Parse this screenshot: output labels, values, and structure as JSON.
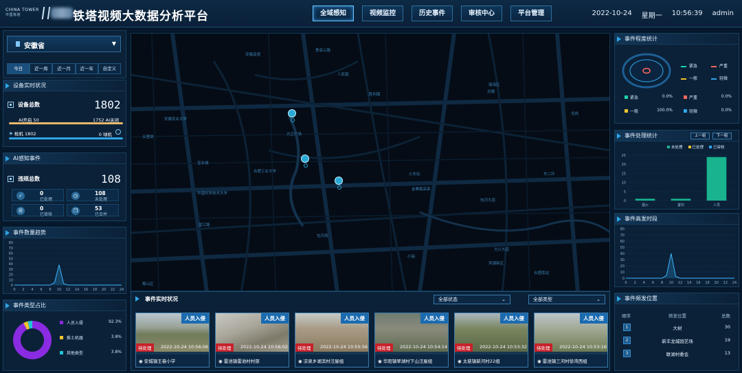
{
  "header": {
    "logo_text": "CHINA TOWER",
    "logo_sub": "中国铁塔",
    "title": "铁塔视频大数据分析平台",
    "nav": [
      "全域感知",
      "视频监控",
      "历史事件",
      "审核中心",
      "平台管理"
    ],
    "date": "2022-10-24",
    "weekday": "星期一",
    "time": "10:56:39",
    "user": "admin"
  },
  "left": {
    "province": "安徽省",
    "ranges": [
      "今日",
      "近一周",
      "近一月",
      "近一年",
      "自定义"
    ],
    "device": {
      "title": "设备实时状况",
      "total_label": "设备总数",
      "total": "1802",
      "ai_on": "AI开启 50",
      "ai_off": "1752 AI关闭",
      "gun": "枪机 1802",
      "dome": "0 球机"
    },
    "ai": {
      "title": "AI感知事件",
      "total_label": "违规总数",
      "total": "108",
      "cells": [
        {
          "value": "0",
          "label": "已处理"
        },
        {
          "value": "108",
          "label": "未处理"
        },
        {
          "value": "0",
          "label": "已审核"
        },
        {
          "value": "53",
          "label": "已合并"
        }
      ]
    },
    "trend": {
      "title": "事件数量趋势",
      "y_ticks": [
        "80",
        "70",
        "60",
        "50",
        "40",
        "30",
        "20",
        "10",
        "0"
      ],
      "x_ticks": [
        "0",
        "2",
        "4",
        "6",
        "8",
        "10",
        "12",
        "14",
        "16",
        "18",
        "20",
        "22",
        "24"
      ]
    },
    "types": {
      "title": "事件类型占比",
      "items": [
        {
          "label": "人员入侵",
          "value": "92.3%",
          "color": "#8a2be2"
        },
        {
          "label": "推土机器",
          "value": "3.8%",
          "color": "#f0c330"
        },
        {
          "label": "其他类型",
          "value": "3.8%",
          "color": "#21c4d6"
        }
      ]
    }
  },
  "map": {
    "labels": [
      {
        "t": "安徽高速"
      },
      {
        "t": "季高公路"
      },
      {
        "t": "人民路"
      },
      {
        "t": "方正广场"
      },
      {
        "t": "安徽农业大学"
      },
      {
        "t": "五里墩"
      },
      {
        "t": "合肥工业大学"
      },
      {
        "t": "宝业城"
      },
      {
        "t": "中国科学技术大学"
      },
      {
        "t": "望江路"
      },
      {
        "t": "包河苑"
      },
      {
        "t": "滨湖新区"
      },
      {
        "t": "瑶海区"
      },
      {
        "t": "火车站"
      },
      {
        "t": "包河大道"
      },
      {
        "t": "东二环"
      },
      {
        "t": "金寨路高架"
      },
      {
        "t": "方兴大道"
      },
      {
        "t": "小庙"
      },
      {
        "t": "龙塘"
      },
      {
        "t": "合肥南站"
      },
      {
        "t": "胜利路"
      },
      {
        "t": "龙岗"
      },
      {
        "t": "蜀山区"
      }
    ]
  },
  "events": {
    "title": "事件实时状况",
    "status_select": "全部状态",
    "type_select": "全部类型",
    "cards": [
      {
        "tag": "人员入侵",
        "status": "待处理",
        "time": "2022-10-24 10:56:06",
        "location": "安城镇王巷小学"
      },
      {
        "tag": "人员入侵",
        "status": "待处理",
        "time": "2022-10-24 10:56:02",
        "location": "雷池镇雷池村村部"
      },
      {
        "tag": "人员入侵",
        "status": "待处理",
        "time": "2022-10-24 10:55:56",
        "location": "凉泉乡湖滨村汪屋组"
      },
      {
        "tag": "人员入侵",
        "status": "待处理",
        "time": "2022-10-24 10:54:14",
        "location": "华阳镇翠湖村下山汪屋组"
      },
      {
        "tag": "人员入侵",
        "status": "待处理",
        "time": "2022-10-24 10:53:32",
        "location": "太慈镇新河村22组"
      },
      {
        "tag": "人员入侵",
        "status": "待处理",
        "time": "2022-10-24 10:53:16",
        "location": "雷池镇三河村徐湾西组"
      }
    ]
  },
  "right": {
    "level": {
      "title": "事件程度统计",
      "legend": [
        {
          "label": "紧急",
          "color": "#19d3a7"
        },
        {
          "label": "严重",
          "color": "#ff6a5c"
        },
        {
          "label": "一般",
          "color": "#f0c330"
        },
        {
          "label": "轻微",
          "color": "#2fa6e8"
        }
      ],
      "pcts": [
        {
          "label": "紧急",
          "value": "0.0%"
        },
        {
          "label": "严重",
          "value": "0.0%"
        },
        {
          "label": "一般",
          "value": "100.0%"
        },
        {
          "label": "轻微",
          "value": "0.0%"
        }
      ]
    },
    "handle": {
      "title": "事件处理统计",
      "prev": "上一组",
      "next": "下一组",
      "legend": [
        "未处理",
        "已处理",
        "已审核"
      ],
      "y_ticks": [
        "25",
        "20",
        "15",
        "10",
        "5",
        "0"
      ],
      "categories": [
        "烟火",
        "垂钓",
        "人员"
      ]
    },
    "hours": {
      "title": "事件高发时段",
      "y_ticks": [
        "80",
        "70",
        "60",
        "50",
        "40",
        "30",
        "20",
        "10",
        "0"
      ],
      "x_ticks": [
        "0",
        "2",
        "4",
        "6",
        "8",
        "10",
        "12",
        "14",
        "16",
        "18",
        "20",
        "22",
        "24"
      ]
    },
    "freq": {
      "title": "事件频发位置",
      "headers": [
        "顺序",
        "频发位置",
        "总数"
      ],
      "rows": [
        {
          "n": "1",
          "loc": "大树",
          "total": "30"
        },
        {
          "n": "2",
          "loc": "新丰龙城园艺场",
          "total": "19"
        },
        {
          "n": "3",
          "loc": "联湖村委会",
          "total": "13"
        }
      ]
    }
  },
  "chart_data": [
    {
      "type": "area",
      "title": "事件数量趋势",
      "x": [
        0,
        2,
        4,
        6,
        8,
        9,
        10,
        11,
        12,
        14,
        16,
        18,
        20,
        22,
        24
      ],
      "values": [
        0,
        0,
        0,
        0,
        0,
        5,
        38,
        3,
        0,
        0,
        0,
        0,
        0,
        0,
        0
      ],
      "ylim": [
        0,
        80
      ]
    },
    {
      "type": "bar",
      "title": "事件处理统计",
      "categories": [
        "烟火",
        "垂钓",
        "人员"
      ],
      "series": [
        {
          "name": "未处理",
          "values": [
            1,
            1,
            24
          ]
        },
        {
          "name": "已处理",
          "values": [
            0,
            0,
            0
          ]
        },
        {
          "name": "已审核",
          "values": [
            0,
            0,
            0
          ]
        }
      ],
      "ylim": [
        0,
        25
      ]
    },
    {
      "type": "area",
      "title": "事件高发时段",
      "x": [
        0,
        2,
        4,
        6,
        8,
        9,
        10,
        11,
        12,
        14,
        16,
        18,
        20,
        22,
        24
      ],
      "values": [
        0,
        0,
        0,
        0,
        0,
        5,
        40,
        3,
        0,
        0,
        0,
        0,
        0,
        0,
        0
      ],
      "ylim": [
        0,
        80
      ]
    },
    {
      "type": "pie",
      "title": "事件类型占比",
      "categories": [
        "人员入侵",
        "推土机器",
        "其他类型"
      ],
      "values": [
        92.3,
        3.8,
        3.8
      ]
    }
  ]
}
